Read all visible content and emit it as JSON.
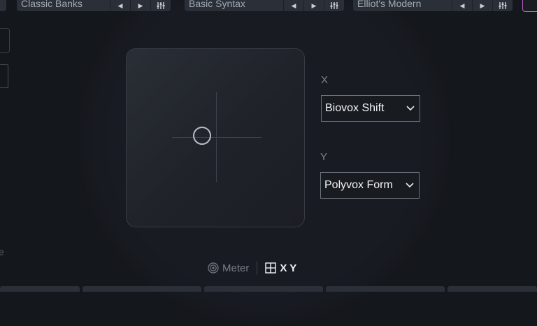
{
  "presets": [
    {
      "name": "Classic Banks"
    },
    {
      "name": "Basic Syntax"
    },
    {
      "name": "Elliot's Modern"
    }
  ],
  "icons": {
    "prev": "triangle-left-icon",
    "next": "triangle-right-icon",
    "mixer": "sliders-icon",
    "dropdown": "chevron-down-icon",
    "meter": "concentric-circles-icon",
    "xy": "grid-square-icon"
  },
  "xy_pad": {
    "x_axis_label": "X",
    "y_axis_label": "Y",
    "x_selection": "Biovox Shift",
    "y_selection": "Polyvox Form"
  },
  "view_toggle": {
    "meter_label": "Meter",
    "xy_label": "X Y",
    "active": "X Y"
  },
  "left_partial_text": "e",
  "colors": {
    "background": "#14171c",
    "circle": "#181b21",
    "accent_pink": "#b764c8",
    "text_primary": "#f2f4f7",
    "text_muted": "#7d838c"
  }
}
